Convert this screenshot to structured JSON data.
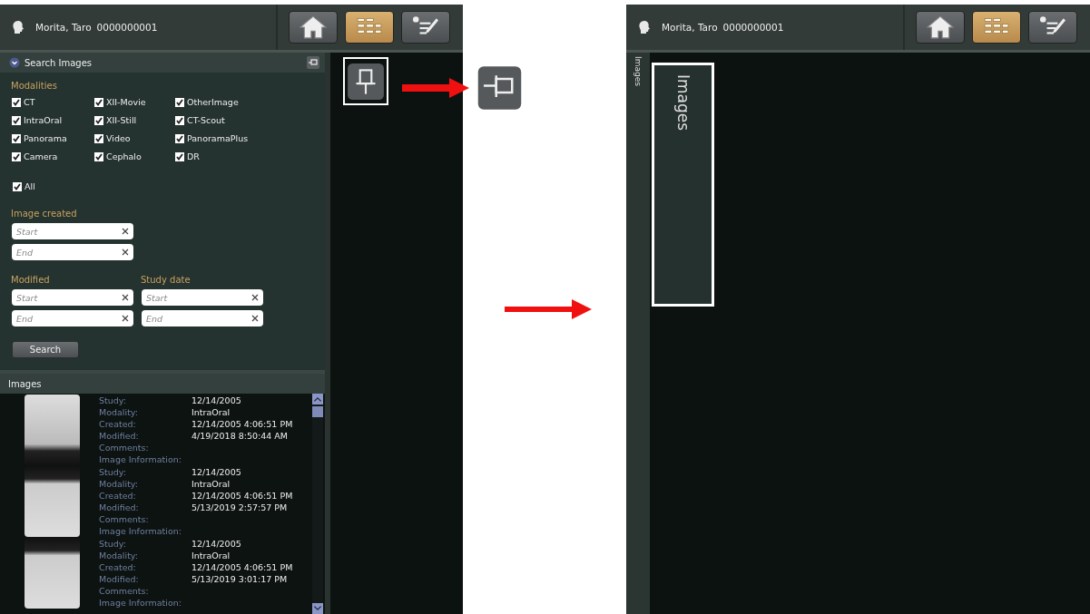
{
  "left_screen": {
    "header": {
      "patient_name": "Morita, Taro",
      "patient_id": "0000000001",
      "toolbar": [
        {
          "kind": "home",
          "selected": false
        },
        {
          "kind": "list",
          "selected": true
        },
        {
          "kind": "notes",
          "selected": false
        }
      ]
    },
    "search_panel": {
      "title": "Search Images",
      "expanded": true,
      "modalities_label": "Modalities",
      "modalities": [
        {
          "label": "CT",
          "checked": true
        },
        {
          "label": "XII-Movie",
          "checked": true
        },
        {
          "label": "OtherImage",
          "checked": true
        },
        {
          "label": "IntraOral",
          "checked": true
        },
        {
          "label": "XII-Still",
          "checked": true
        },
        {
          "label": "CT-Scout",
          "checked": true
        },
        {
          "label": "Panorama",
          "checked": true
        },
        {
          "label": "Video",
          "checked": true
        },
        {
          "label": "PanoramaPlus",
          "checked": true
        },
        {
          "label": "Camera",
          "checked": true
        },
        {
          "label": "Cephalo",
          "checked": true
        },
        {
          "label": "DR",
          "checked": true
        }
      ],
      "all": {
        "label": "All",
        "checked": true
      },
      "image_created": {
        "label": "Image created",
        "fields": [
          {
            "placeholder": "Start"
          },
          {
            "placeholder": "End"
          }
        ]
      },
      "modified": {
        "label": "Modified",
        "fields": [
          {
            "placeholder": "Start"
          },
          {
            "placeholder": "End"
          }
        ]
      },
      "study_date": {
        "label": "Study date",
        "fields": [
          {
            "placeholder": "Start"
          },
          {
            "placeholder": "End"
          }
        ]
      },
      "search_button": "Search"
    },
    "images": {
      "title": "Images",
      "items": [
        {
          "fields": [
            {
              "label": "Study:",
              "value": "12/14/2005"
            },
            {
              "label": "Modality:",
              "value": "IntraOral"
            },
            {
              "label": "Created:",
              "value": "12/14/2005 4:06:51 PM"
            },
            {
              "label": "Modified:",
              "value": "4/19/2018 8:50:44 AM"
            },
            {
              "label": "Comments:"
            },
            {
              "label": "Image Information:"
            }
          ]
        },
        {
          "fields": [
            {
              "label": "Study:",
              "value": "12/14/2005"
            },
            {
              "label": "Modality:",
              "value": "IntraOral"
            },
            {
              "label": "Created:",
              "value": "12/14/2005 4:06:51 PM"
            },
            {
              "label": "Modified:",
              "value": "5/13/2019 2:57:57 PM"
            },
            {
              "label": "Comments:"
            },
            {
              "label": "Image Information:"
            }
          ]
        },
        {
          "fields": [
            {
              "label": "Study:",
              "value": "12/14/2005"
            },
            {
              "label": "Modality:",
              "value": "IntraOral"
            },
            {
              "label": "Created:",
              "value": "12/14/2005 4:06:51 PM"
            },
            {
              "label": "Modified:",
              "value": "5/13/2019 3:01:17 PM"
            },
            {
              "label": "Comments:"
            },
            {
              "label": "Image Information:"
            }
          ]
        }
      ]
    },
    "pin_button": {
      "highlighted": true
    }
  },
  "right_screen": {
    "header": {
      "patient_name": "Morita, Taro",
      "patient_id": "0000000001",
      "toolbar": [
        {
          "kind": "home",
          "selected": false
        },
        {
          "kind": "list",
          "selected": true
        },
        {
          "kind": "notes",
          "selected": false
        }
      ]
    },
    "side_tab": "Images",
    "images_tab": {
      "label": "Images",
      "highlighted": true
    }
  }
}
